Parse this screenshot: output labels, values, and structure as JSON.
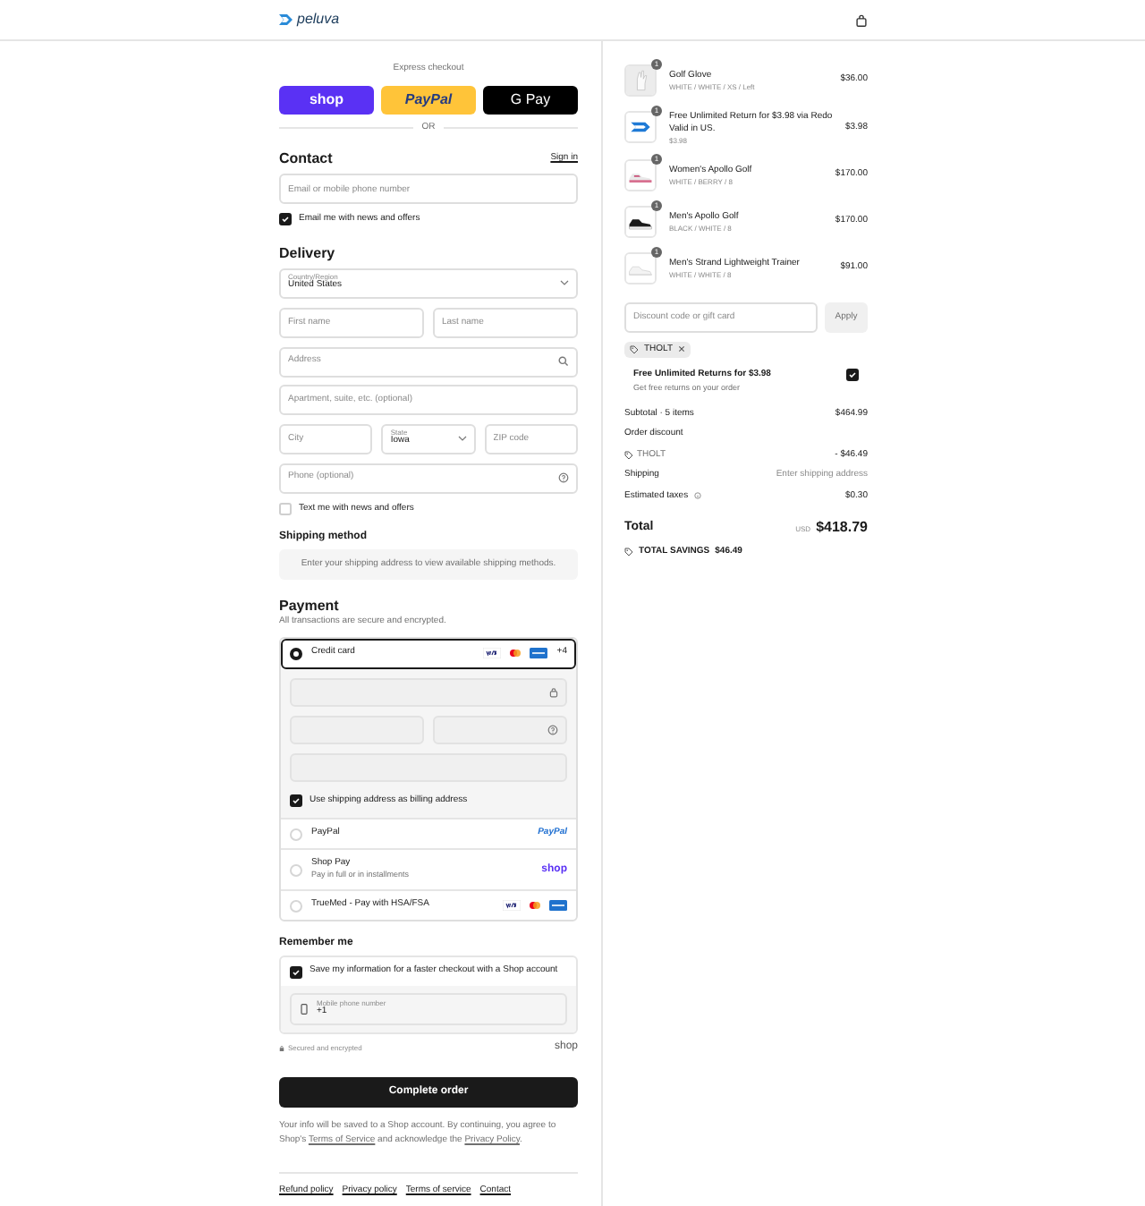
{
  "header": {
    "logo": "peluva"
  },
  "express_checkout": {
    "title": "Express checkout",
    "buttons": [
      {
        "kind": "shop",
        "label": "shop"
      },
      {
        "kind": "paypal",
        "label": "PayPal"
      },
      {
        "kind": "gpay",
        "label": "G Pay"
      }
    ],
    "divider": "OR"
  },
  "contact": {
    "title": "Contact",
    "sign_in": "Sign in",
    "email": {
      "placeholder": "Email or mobile phone number"
    },
    "news": {
      "label": "Email me with news and offers",
      "checked": true
    }
  },
  "delivery": {
    "title": "Delivery",
    "country": {
      "label": "Country/Region",
      "value": "United States"
    },
    "first_name": {
      "placeholder": "First name"
    },
    "last_name": {
      "placeholder": "Last name"
    },
    "address": {
      "placeholder": "Address"
    },
    "apartment": {
      "placeholder": "Apartment, suite, etc. (optional)"
    },
    "city": {
      "placeholder": "City"
    },
    "state": {
      "label": "State",
      "value": "Iowa"
    },
    "zip": {
      "placeholder": "ZIP code"
    },
    "phone": {
      "placeholder": "Phone (optional)"
    },
    "sms": {
      "label": "Text me with news and offers",
      "checked": false
    }
  },
  "shipping_method": {
    "title": "Shipping method",
    "message": "Enter your shipping address to view available shipping methods."
  },
  "payment": {
    "title": "Payment",
    "subtitle": "All transactions are secure and encrypted.",
    "methods": [
      {
        "kind": "card",
        "label": "Credit card",
        "more": "+4",
        "selected": true
      },
      {
        "kind": "paypal",
        "label": "PayPal",
        "logo": "PayPal",
        "selected": false
      },
      {
        "kind": "shoppay",
        "label": "Shop Pay",
        "sublabel": "Pay in full or in installments",
        "logo": "shop",
        "selected": false
      },
      {
        "kind": "truemed",
        "label": "TrueMed - Pay with HSA/FSA",
        "selected": false
      }
    ],
    "billing": {
      "label": "Use shipping address as billing address",
      "checked": true
    }
  },
  "remember": {
    "title": "Remember me",
    "save": {
      "label": "Save my information for a faster checkout with a Shop account",
      "checked": true
    },
    "phone": {
      "label": "Mobile phone number",
      "value": "+1"
    },
    "secure": "Secured and encrypted",
    "logo": "shop"
  },
  "complete_button": "Complete order",
  "notice": [
    {
      "kind": "text",
      "text": "Your info will be saved to a Shop account. By continuing, you agree to Shop's "
    },
    {
      "kind": "link",
      "text": "Terms of Service"
    },
    {
      "kind": "text",
      "text": " and acknowledge the "
    },
    {
      "kind": "link",
      "text": "Privacy Policy"
    },
    {
      "kind": "text",
      "text": "."
    }
  ],
  "footer_links": [
    "Refund policy",
    "Privacy policy",
    "Terms of service",
    "Contact"
  ],
  "order": {
    "items": [
      {
        "name": "Golf Glove",
        "variant": "WHITE / WHITE / XS / Left",
        "price": "$36.00",
        "quantity": "1",
        "kind": "glove"
      },
      {
        "name": "Free Unlimited Return for $3.98 via Redo",
        "note": "Valid in US.",
        "variant": "$3.98",
        "price": "$3.98",
        "quantity": "1",
        "kind": "returns"
      },
      {
        "name": "Women's Apollo Golf",
        "variant": "WHITE / BERRY / 8",
        "price": "$170.00",
        "quantity": "1",
        "kind": "shoe_light"
      },
      {
        "name": "Men's Apollo Golf",
        "variant": "BLACK / WHITE / 8",
        "price": "$170.00",
        "quantity": "1",
        "kind": "shoe_dark"
      },
      {
        "name": "Men's Strand Lightweight Trainer",
        "variant": "WHITE / WHITE / 8",
        "price": "$91.00",
        "quantity": "1",
        "kind": "shoe_white"
      }
    ],
    "discount": {
      "placeholder": "Discount code or gift card",
      "apply": "Apply",
      "tag": "THOLT"
    },
    "upsell": {
      "title": "Free Unlimited Returns for $3.98",
      "subtitle": "Get free returns on your order",
      "checked": true
    },
    "summary": [
      {
        "kind": "plain",
        "label": "Subtotal · 5 items",
        "value": "$464.99"
      },
      {
        "kind": "heading",
        "label": "Order discount"
      },
      {
        "kind": "code",
        "label": "THOLT",
        "value": "- $46.49"
      },
      {
        "kind": "muted",
        "label": "Shipping",
        "value": "Enter shipping address"
      },
      {
        "kind": "info",
        "label": "Estimated taxes",
        "value": "$0.30"
      }
    ],
    "total": {
      "label": "Total",
      "currency": "USD",
      "value": "$418.79"
    },
    "savings": {
      "label": "TOTAL SAVINGS",
      "value": "$46.49"
    }
  }
}
